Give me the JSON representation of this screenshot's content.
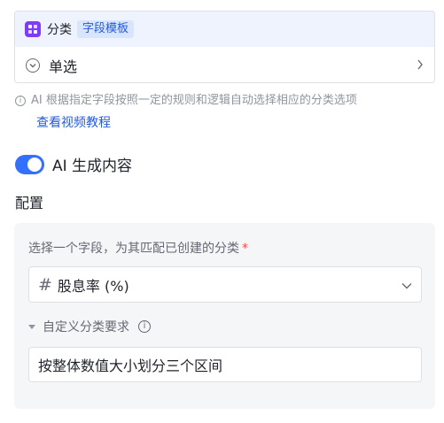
{
  "field_type": {
    "name": "分类",
    "tag": "字段模板",
    "mode": "单选",
    "icon_color": "#7f3bf5"
  },
  "info": {
    "text": "AI 根据指定字段按照一定的规则和逻辑自动选择相应的分类选项",
    "link": "查看视频教程"
  },
  "ai_toggle": {
    "label": "AI 生成内容",
    "on": true,
    "color": "#3370ff"
  },
  "section_title": "配置",
  "config": {
    "field_label": "选择一个字段，为其匹配已创建的分类",
    "required_mark": "*",
    "selected_field_icon": "#",
    "selected_field": "股息率 (%)",
    "custom_label": "自定义分类要求",
    "custom_value": "按整体数值大小划分三个区间"
  }
}
